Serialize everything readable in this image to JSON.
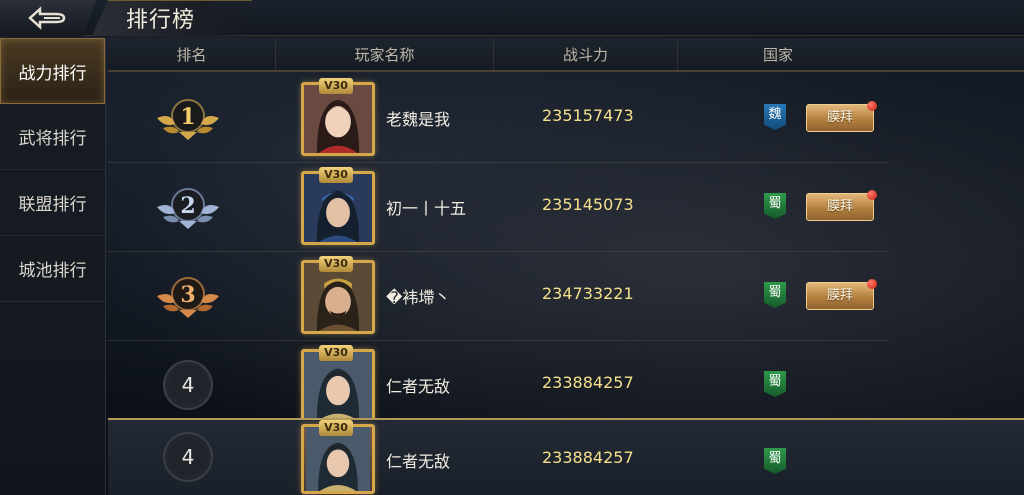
{
  "header_bar": {
    "title": "排行榜"
  },
  "sidebar": {
    "items": [
      {
        "label": "战力排行",
        "active": true
      },
      {
        "label": "武将排行",
        "active": false
      },
      {
        "label": "联盟排行",
        "active": false
      },
      {
        "label": "城池排行",
        "active": false
      }
    ]
  },
  "table": {
    "columns": [
      "排名",
      "玩家名称",
      "战斗力",
      "国家"
    ],
    "rows": [
      {
        "rank": "1",
        "vip": "V30",
        "name": "老魏是我",
        "power": "235157473",
        "nation": "魏",
        "nation_color": "#2a7ab8",
        "worship_label": "膜拜"
      },
      {
        "rank": "2",
        "vip": "V30",
        "name": "初一丨十五",
        "power": "235145073",
        "nation": "蜀",
        "nation_color": "#2f9a4a",
        "worship_label": "膜拜"
      },
      {
        "rank": "3",
        "vip": "V30",
        "name": "�袆墆丶",
        "power": "234733221",
        "nation": "蜀",
        "nation_color": "#2f9a4a",
        "worship_label": "膜拜"
      },
      {
        "rank": "4",
        "vip": "V30",
        "name": "仁者无敌",
        "power": "233884257",
        "nation": "蜀",
        "nation_color": "#2f9a4a"
      }
    ]
  },
  "my_rank": {
    "rank": "4",
    "vip": "V30",
    "name": "仁者无敌",
    "power": "233884257",
    "nation": "蜀",
    "nation_color": "#2f9a4a"
  },
  "colors": {
    "gold": "#d4a84a",
    "silver": "#9fb4d6",
    "bronze": "#d48a4a",
    "power_text": "#f5e08c"
  }
}
